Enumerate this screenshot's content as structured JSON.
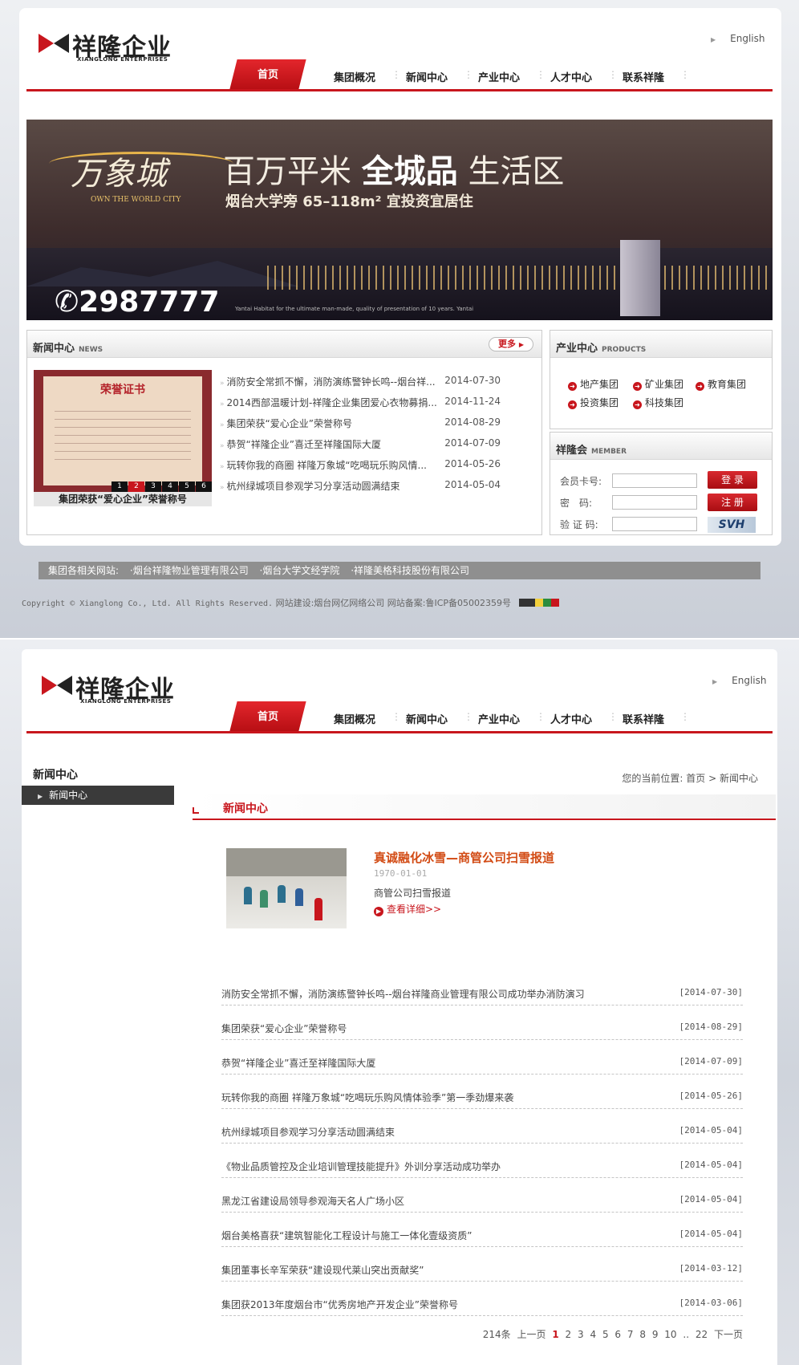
{
  "brand": {
    "name_cn": "祥隆企业",
    "name_en": "XIANGLONG ENTERPRISES"
  },
  "header": {
    "english_link": "English"
  },
  "nav": {
    "items": [
      "首页",
      "集团概况",
      "新闻中心",
      "产业中心",
      "人才中心",
      "联系祥隆"
    ],
    "active": "首页"
  },
  "banner": {
    "brand_cn": "万象城",
    "brand_en": "OWN THE WORLD CITY",
    "headline_1": "百万平米",
    "headline_bold": "全城品",
    "headline_2": "生活区",
    "subline": "烟台大学旁 65–118m² 宜投资宜居住",
    "phone": "2987777",
    "fine_print": "Yantai Habitat for the ultimate man-made, quality of presentation of 10 years. Yantai"
  },
  "news_box": {
    "title": "新闻中心",
    "title_en": "NEWS",
    "more_label": "更多",
    "slide_caption": "集团荣获“爱心企业”荣誉称号",
    "slide_image_title": "荣誉证书",
    "slide_numbers": [
      "1",
      "2",
      "3",
      "4",
      "5",
      "6"
    ],
    "slide_active": "2",
    "items": [
      {
        "title": "消防安全常抓不懈，消防演练警钟长鸣--烟台祥...",
        "date": "2014-07-30"
      },
      {
        "title": "2014西部温暖计划-祥隆企业集团爱心衣物募捐...",
        "date": "2014-11-24"
      },
      {
        "title": "集团荣获“爱心企业”荣誉称号",
        "date": "2014-08-29"
      },
      {
        "title": "恭贺“祥隆企业”喜迁至祥隆国际大厦",
        "date": "2014-07-09"
      },
      {
        "title": "玩转你我的商圈 祥隆万象城“吃喝玩乐购风情...",
        "date": "2014-05-26"
      },
      {
        "title": "杭州绿城项目参观学习分享活动圆满结束",
        "date": "2014-05-04"
      }
    ]
  },
  "products_box": {
    "title": "产业中心",
    "title_en": "PRODUCTS",
    "items": [
      "地产集团",
      "矿业集团",
      "教育集团",
      "投资集团",
      "科技集团"
    ]
  },
  "member_box": {
    "title": "祥隆会",
    "title_en": "MEMBER",
    "card_label": "会员卡号:",
    "password_label": "密　码:",
    "code_label": "验 证 码:",
    "login_label": "登 录",
    "register_label": "注 册",
    "captcha_text": "SVH"
  },
  "footer": {
    "links_label": "集团各相关网站:",
    "links": [
      "·烟台祥隆物业管理有限公司",
      "·烟台大学文经学院",
      "·祥隆美格科技股份有限公司"
    ],
    "copyright": "Copyright © Xianglong Co., Ltd. All Rights Reserved.",
    "built_by": "网站建设:烟台网亿网络公司",
    "icp": "网站备案:鲁ICP备05002359号",
    "counter_label": "CNZZ"
  },
  "news_page": {
    "side_title": "新闻中心",
    "side_item": "新闻中心",
    "crumb_prefix": "您的当前位置:",
    "crumb_home": "首页",
    "crumb_sep": ">",
    "crumb_current": "新闻中心",
    "section_title": "新闻中心",
    "featured": {
      "title": "真诚融化冰雪—商管公司扫雪报道",
      "date": "1970-01-01",
      "desc": "商管公司扫雪报道",
      "more_label": "查看详细>>"
    },
    "list": [
      {
        "title": "消防安全常抓不懈，消防演练警钟长鸣--烟台祥隆商业管理有限公司成功举办消防演习",
        "date": "[2014-07-30]"
      },
      {
        "title": "集团荣获“爱心企业”荣誉称号",
        "date": "[2014-08-29]"
      },
      {
        "title": "恭贺“祥隆企业”喜迁至祥隆国际大厦",
        "date": "[2014-07-09]"
      },
      {
        "title": "玩转你我的商圈 祥隆万象城“吃喝玩乐购风情体验季”第一季劲爆来袭",
        "date": "[2014-05-26]"
      },
      {
        "title": "杭州绿城项目参观学习分享活动圆满结束",
        "date": "[2014-05-04]"
      },
      {
        "title": "《物业品质管控及企业培训管理技能提升》外训分享活动成功举办",
        "date": "[2014-05-04]"
      },
      {
        "title": "黑龙江省建设局领导参观海天名人广场小区",
        "date": "[2014-05-04]"
      },
      {
        "title": "烟台美格喜获“建筑智能化工程设计与施工一体化壹级资质”",
        "date": "[2014-05-04]"
      },
      {
        "title": "集团董事长辛军荣获“建设现代莱山突出贡献奖”",
        "date": "[2014-03-12]"
      },
      {
        "title": "集团获2013年度烟台市“优秀房地产开发企业”荣誉称号",
        "date": "[2014-03-06]"
      }
    ],
    "pager": {
      "total": "214条",
      "prev": "上一页",
      "pages": [
        "1",
        "2",
        "3",
        "4",
        "5",
        "6",
        "7",
        "8",
        "9",
        "10",
        "..",
        "22"
      ],
      "current": "1",
      "next": "下一页"
    }
  },
  "colors": {
    "accent": "#c8161d",
    "featured_title": "#d24a13",
    "footer_bar": "#8f8f8f"
  }
}
